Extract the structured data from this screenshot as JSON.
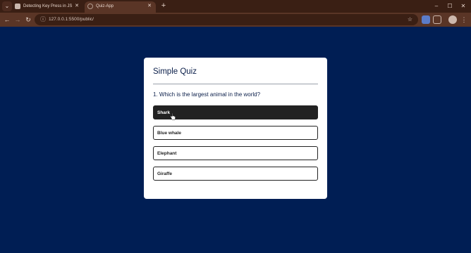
{
  "browser": {
    "tabs": [
      {
        "title": "Detecting Key Press in JS",
        "active": false
      },
      {
        "title": "Quiz-App",
        "active": true
      }
    ],
    "url": "127.0.0.1:5500/public/"
  },
  "quiz": {
    "title": "Simple Quiz",
    "question": "1. Which is the largest animal in the world?",
    "answers": [
      {
        "label": "Shark",
        "selected": true
      },
      {
        "label": "Blue whale",
        "selected": false
      },
      {
        "label": "Elephant",
        "selected": false
      },
      {
        "label": "Giraffe",
        "selected": false
      }
    ]
  },
  "colors": {
    "page_background": "#001e54",
    "card_background": "#ffffff",
    "selected_answer": "#222222",
    "browser_frame": "#5a3526"
  }
}
